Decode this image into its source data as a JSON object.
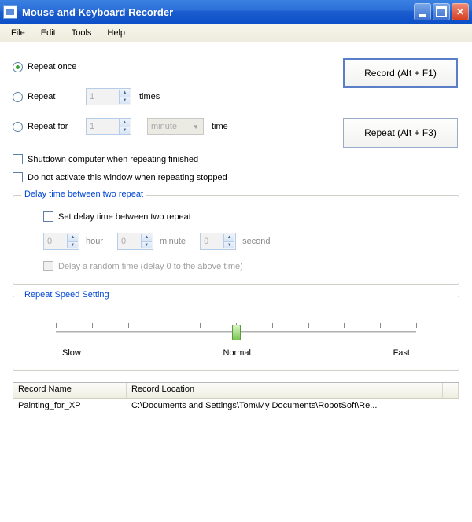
{
  "title": "Mouse and Keyboard Recorder",
  "menu": {
    "file": "File",
    "edit": "Edit",
    "tools": "Tools",
    "help": "Help"
  },
  "repeat": {
    "once": "Repeat once",
    "n": "Repeat",
    "n_value": "1",
    "n_suffix": "times",
    "for": "Repeat for",
    "for_value": "1",
    "for_unit": "minute",
    "for_suffix": "time"
  },
  "buttons": {
    "record": "Record (Alt + F1)",
    "repeat": "Repeat (Alt + F3)"
  },
  "options": {
    "shutdown": "Shutdown computer when repeating finished",
    "noactivate": "Do not activate this window when repeating stopped"
  },
  "delay": {
    "legend": "Delay time between two repeat",
    "set": "Set delay time between two repeat",
    "h": "0",
    "h_label": "hour",
    "m": "0",
    "m_label": "minute",
    "s": "0",
    "s_label": "second",
    "random": "Delay a random time (delay 0 to the above time)"
  },
  "speed": {
    "legend": "Repeat Speed Setting",
    "slow": "Slow",
    "normal": "Normal",
    "fast": "Fast"
  },
  "table": {
    "col_name": "Record Name",
    "col_loc": "Record Location",
    "rows": [
      {
        "name": "Painting_for_XP",
        "loc": "C:\\Documents and Settings\\Tom\\My Documents\\RobotSoft\\Re..."
      }
    ]
  }
}
